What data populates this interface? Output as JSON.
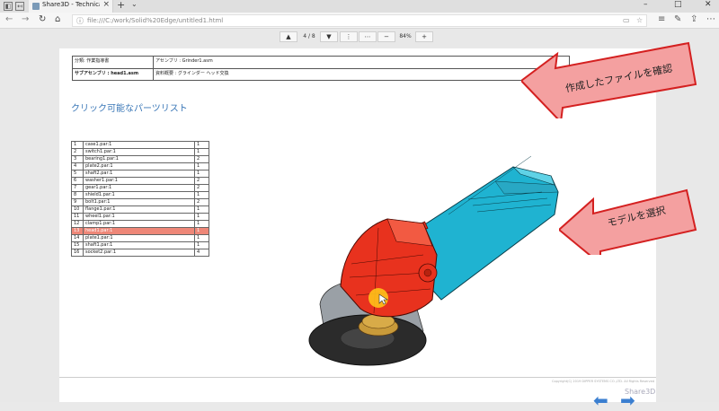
{
  "browser": {
    "tab_title": "Share3D - Technical Pub",
    "address": "file:///C:/work/Solid%20Edge/untitled1.html"
  },
  "viewer_toolbar": {
    "page_display": "4 / 8",
    "zoom": "84%"
  },
  "document_header": {
    "category": "分類: 作業指導書",
    "assembly": "アセンブリ : Grinder1.asm",
    "subassembly": "サブアセンブリ : head1.asm",
    "summary": "資料概要 : グラインダー ヘッド交換"
  },
  "parts_list": {
    "title": "クリック可能なパーツリスト",
    "rows": [
      {
        "no": "1",
        "name": "case1.par:1",
        "qty": "1"
      },
      {
        "no": "2",
        "name": "switch1.par:1",
        "qty": "1"
      },
      {
        "no": "3",
        "name": "bearing1.par:1",
        "qty": "2"
      },
      {
        "no": "4",
        "name": "plate2.par:1",
        "qty": "1"
      },
      {
        "no": "5",
        "name": "shaft2.par:1",
        "qty": "1"
      },
      {
        "no": "6",
        "name": "washer1.par:1",
        "qty": "2"
      },
      {
        "no": "7",
        "name": "gear1.par:1",
        "qty": "2"
      },
      {
        "no": "8",
        "name": "shield1.par:1",
        "qty": "1"
      },
      {
        "no": "9",
        "name": "bolt1.par:1",
        "qty": "2"
      },
      {
        "no": "10",
        "name": "flange1.par:1",
        "qty": "1"
      },
      {
        "no": "11",
        "name": "wheel1.par:1",
        "qty": "1"
      },
      {
        "no": "12",
        "name": "clamp1.par:1",
        "qty": "1"
      },
      {
        "no": "13",
        "name": "head1.par:1",
        "qty": "1",
        "highlighted": true
      },
      {
        "no": "14",
        "name": "plate1.par:1",
        "qty": "1"
      },
      {
        "no": "15",
        "name": "shaft1.par:1",
        "qty": "1"
      },
      {
        "no": "16",
        "name": "socket2.par:1",
        "qty": "4"
      }
    ]
  },
  "callouts": {
    "top": "作成したファイルを確認",
    "middle": "モデルを選択"
  },
  "footer": {
    "copyright": "Copyright(C) 2019 DIPPER SYSTEMS CO.,LTD. All Rights Reserved",
    "brand": "Share3D"
  },
  "colors": {
    "title": "#3a77b7",
    "highlight_row": "#ee8778",
    "grinder_body": "#1fb3d1",
    "grinder_head": "#e8321e",
    "nav_arrow": "#3b7fd0",
    "callout_fill": "#f4a0a0",
    "callout_stroke": "#d42020"
  },
  "icons": [
    "back-icon",
    "forward-icon",
    "refresh-icon",
    "home-icon",
    "file-icon",
    "reading-view-icon",
    "favorite-icon",
    "menu-icon",
    "arrow-up-icon",
    "arrow-down-icon",
    "zoom-out-icon",
    "zoom-in-icon",
    "fit-width-icon",
    "more-icon",
    "prev-page-icon",
    "next-page-icon"
  ]
}
